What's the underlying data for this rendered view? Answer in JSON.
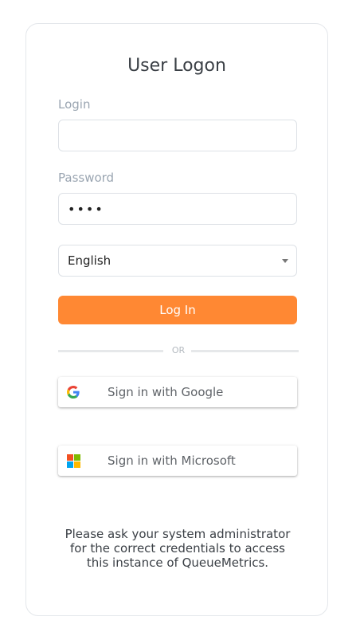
{
  "form": {
    "title": "User Logon",
    "login_label": "Login",
    "login_value": "",
    "password_label": "Password",
    "password_value": "••••",
    "language_selected": "English",
    "login_button": "Log In",
    "divider_text": "OR"
  },
  "social": {
    "google_label": "Sign in with Google",
    "microsoft_label": "Sign in with Microsoft"
  },
  "footer": {
    "line1": "Please ask your system administrator",
    "line2": "for the correct credentials to access",
    "line3": "this instance of QueueMetrics."
  },
  "colors": {
    "accent": "#ff8833",
    "label": "#9aa5b1",
    "text": "#3a3f45"
  },
  "icons": {
    "google": "google-icon",
    "microsoft": "microsoft-icon",
    "dropdown": "chevron-down-icon"
  }
}
